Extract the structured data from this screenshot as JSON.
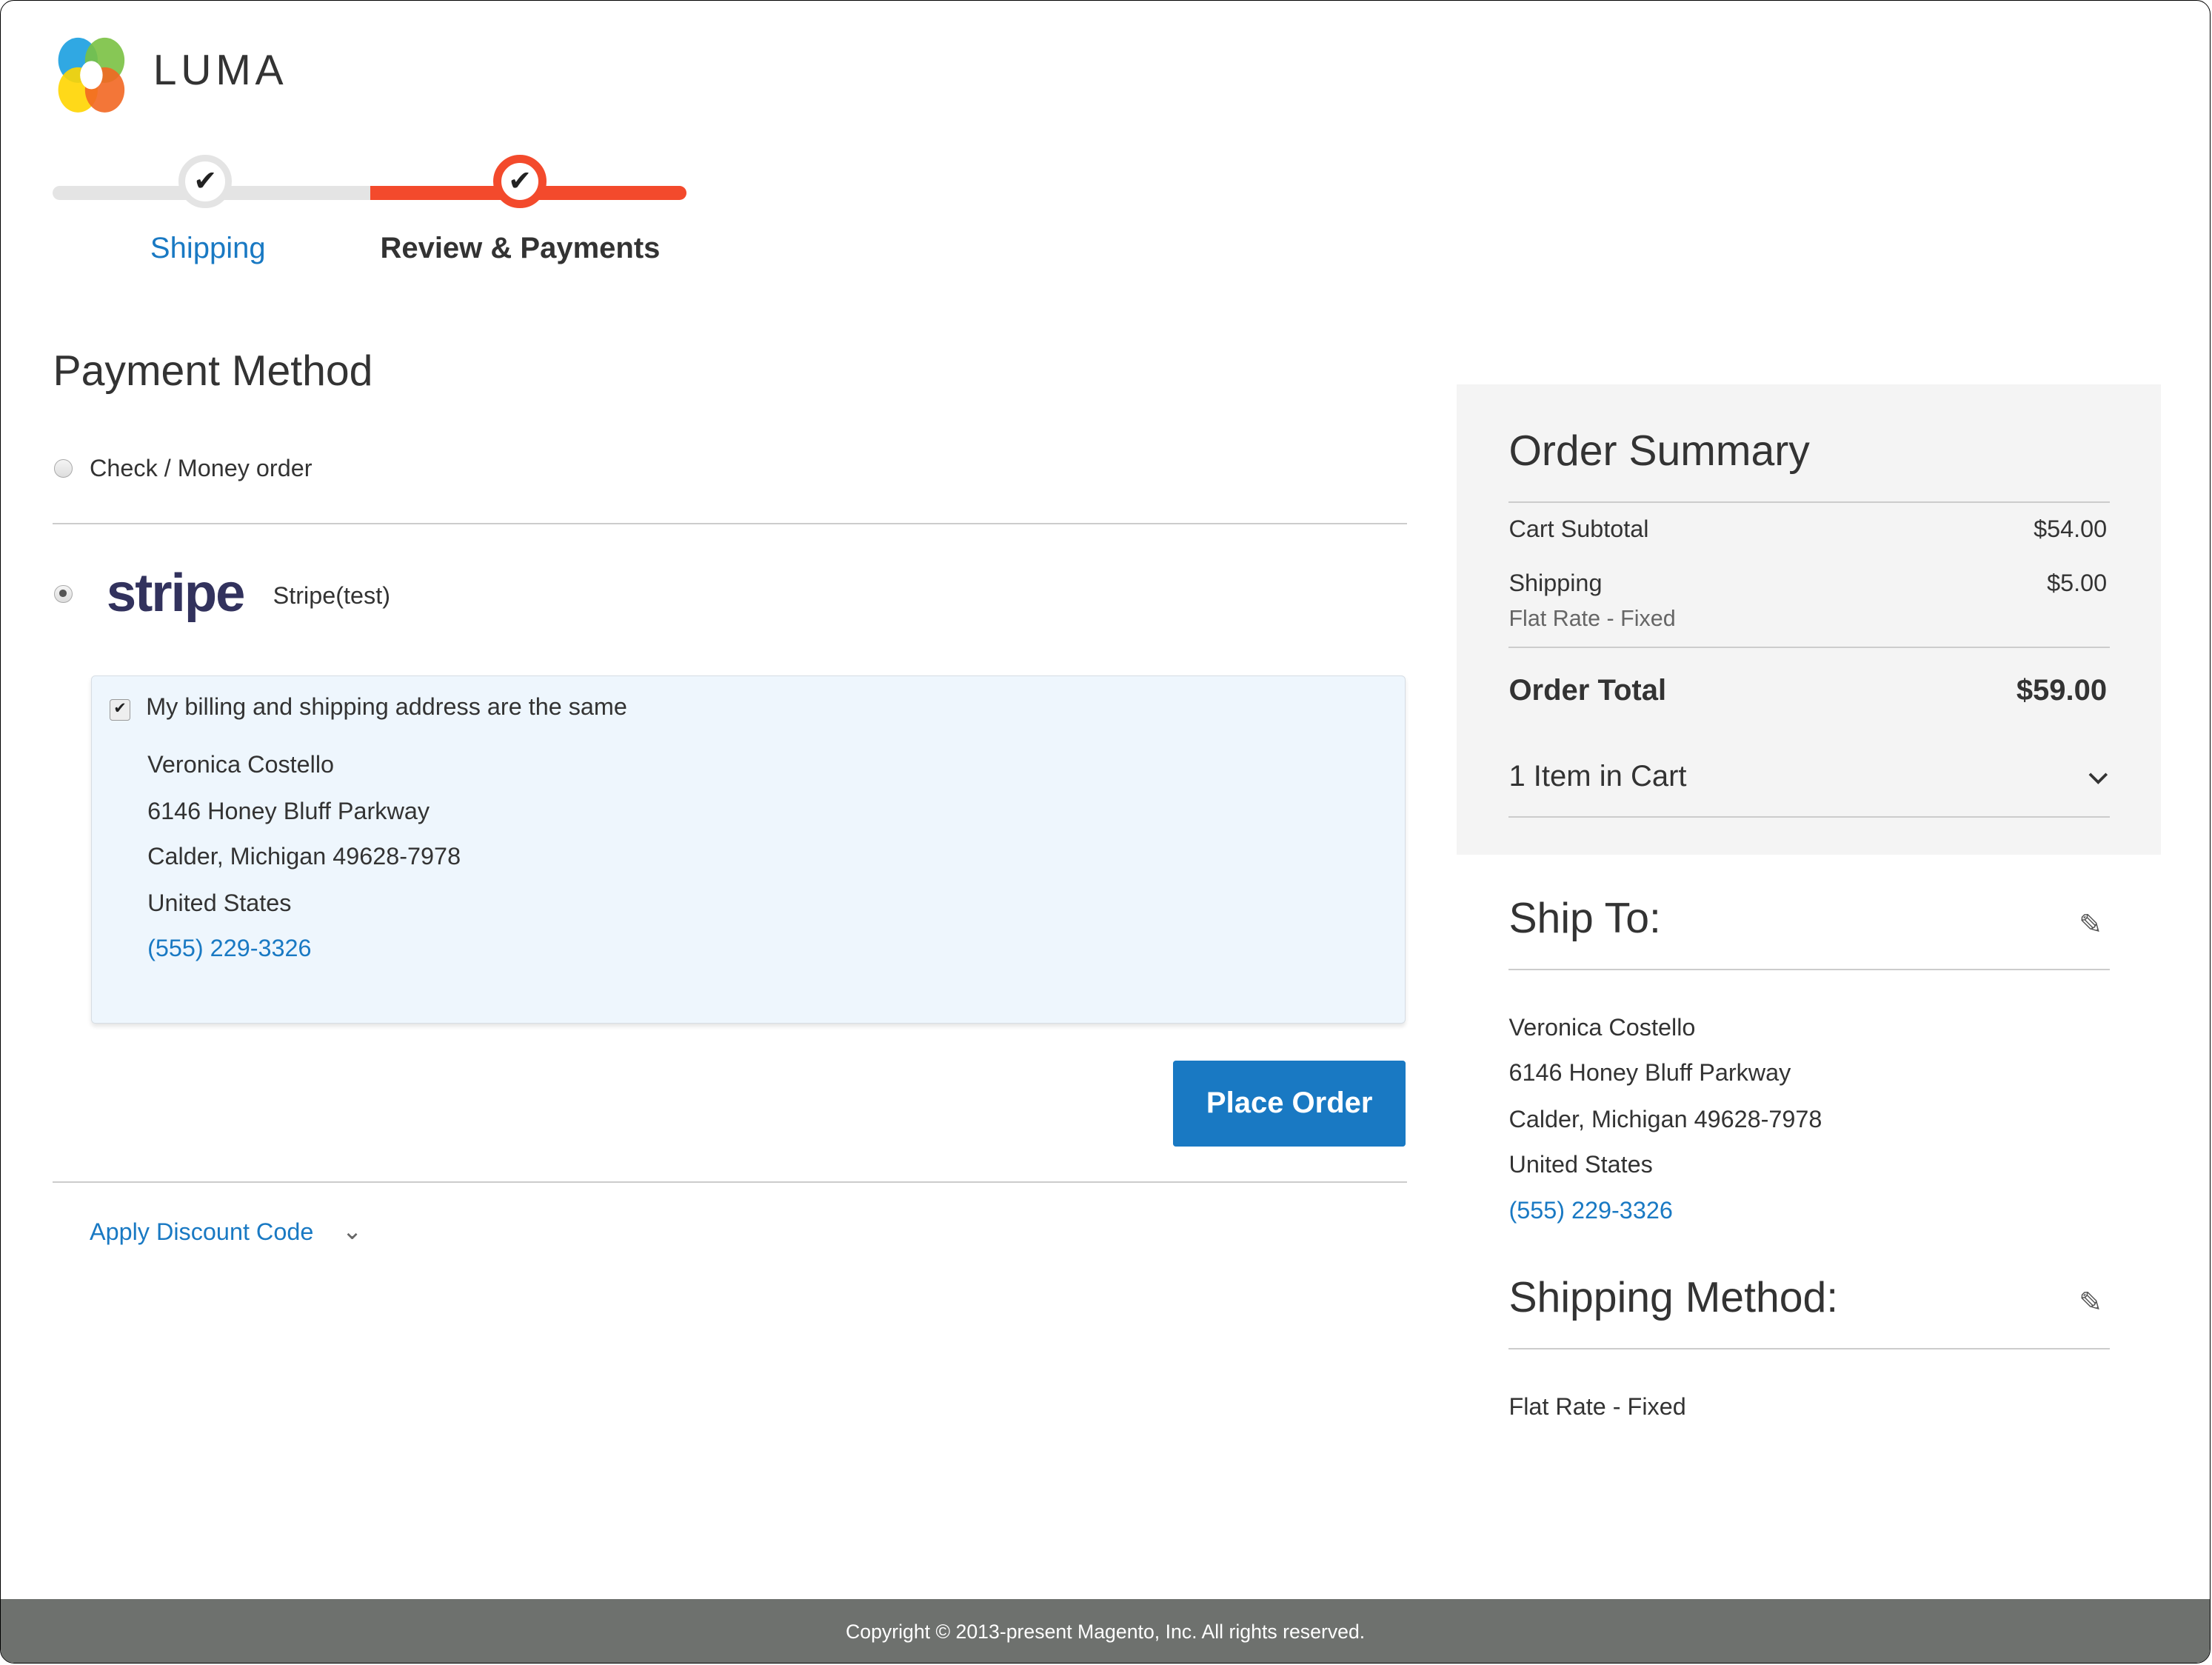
{
  "brand": {
    "name": "LUMA"
  },
  "progress": {
    "steps": [
      {
        "label": "Shipping",
        "state": "complete"
      },
      {
        "label": "Review & Payments",
        "state": "active"
      }
    ],
    "check_glyph": "✔"
  },
  "payment": {
    "title": "Payment Method",
    "options": [
      {
        "label": "Check / Money order",
        "selected": false
      },
      {
        "logo": "stripe",
        "label": "Stripe(test)",
        "selected": true
      }
    ],
    "billing_same_label": "My billing and shipping address are the same",
    "billing_same_checked": true,
    "address": {
      "name": "Veronica Costello",
      "street": "6146 Honey Bluff Parkway",
      "city_line": "Calder, Michigan 49628-7978",
      "country": "United States",
      "phone": "(555) 229-3326"
    },
    "place_order_label": "Place Order",
    "discount_label": "Apply Discount Code"
  },
  "summary": {
    "title": "Order Summary",
    "subtotal_label": "Cart Subtotal",
    "subtotal_value": "$54.00",
    "shipping_label": "Shipping",
    "shipping_value": "$5.00",
    "shipping_method": "Flat Rate - Fixed",
    "total_label": "Order Total",
    "total_value": "$59.00",
    "items_label": "1 Item in Cart"
  },
  "ship_to": {
    "title": "Ship To:",
    "name": "Veronica Costello",
    "street": "6146 Honey Bluff Parkway",
    "city_line": "Calder, Michigan 49628-7978",
    "country": "United States",
    "phone": "(555) 229-3326"
  },
  "shipping_method": {
    "title": "Shipping Method:",
    "value": "Flat Rate - Fixed"
  },
  "footer": {
    "copyright": "Copyright © 2013-present Magento, Inc. All rights reserved."
  },
  "colors": {
    "accent_blue": "#1979c3",
    "progress_red": "#f34a2c",
    "footer_gray": "#6e716e"
  }
}
